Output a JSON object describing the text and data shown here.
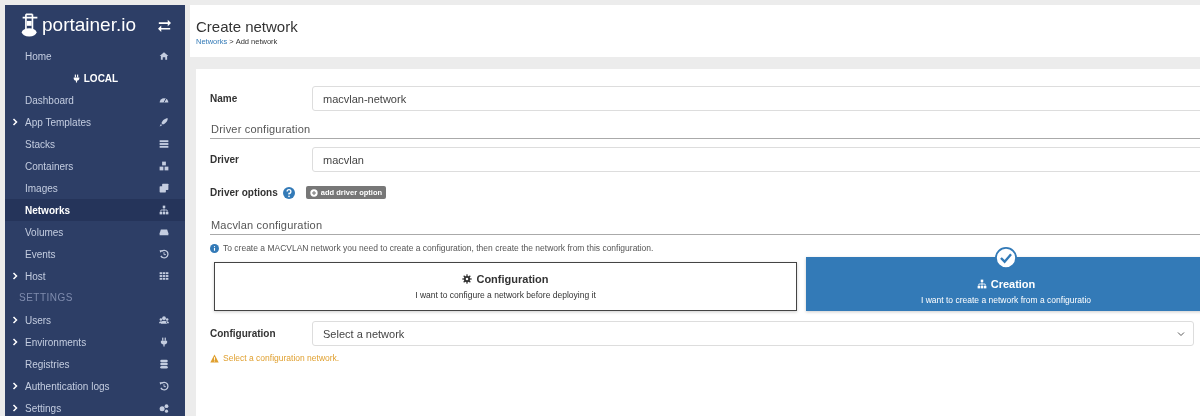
{
  "sidebar": {
    "logo": "portainer.io",
    "items": [
      {
        "kind": "link",
        "label": "Home",
        "expandable": false,
        "selected": false
      },
      {
        "kind": "endpoint",
        "label": "LOCAL"
      },
      {
        "kind": "link",
        "label": "Dashboard",
        "expandable": false,
        "selected": false
      },
      {
        "kind": "link",
        "label": "App Templates",
        "expandable": true,
        "selected": false
      },
      {
        "kind": "link",
        "label": "Stacks",
        "expandable": false,
        "selected": false
      },
      {
        "kind": "link",
        "label": "Containers",
        "expandable": false,
        "selected": false
      },
      {
        "kind": "link",
        "label": "Images",
        "expandable": false,
        "selected": false
      },
      {
        "kind": "link",
        "label": "Networks",
        "expandable": false,
        "selected": true
      },
      {
        "kind": "link",
        "label": "Volumes",
        "expandable": false,
        "selected": false
      },
      {
        "kind": "link",
        "label": "Events",
        "expandable": false,
        "selected": false
      },
      {
        "kind": "link",
        "label": "Host",
        "expandable": true,
        "selected": false
      },
      {
        "kind": "section",
        "label": "SETTINGS"
      },
      {
        "kind": "link",
        "label": "Users",
        "expandable": true,
        "selected": false
      },
      {
        "kind": "link",
        "label": "Environments",
        "expandable": true,
        "selected": false
      },
      {
        "kind": "link",
        "label": "Registries",
        "expandable": false,
        "selected": false
      },
      {
        "kind": "link",
        "label": "Authentication logs",
        "expandable": true,
        "selected": false
      },
      {
        "kind": "link",
        "label": "Settings",
        "expandable": true,
        "selected": false
      }
    ]
  },
  "header": {
    "title": "Create network",
    "breadcrumb": {
      "link": "Networks",
      "separator": ">",
      "current": "Add network"
    }
  },
  "form": {
    "name": {
      "label": "Name",
      "value": "macvlan-network"
    },
    "driver_section": "Driver configuration",
    "driver": {
      "label": "Driver",
      "value": "macvlan"
    },
    "driver_options": {
      "label": "Driver options",
      "button": "add driver option"
    },
    "macvlan_section": "Macvlan configuration",
    "info": "To create a MACVLAN network you need to create a configuration, then create the network from this configuration.",
    "cards": [
      {
        "title": "Configuration",
        "description": "I want to configure a network before deploying it",
        "selected": false
      },
      {
        "title": "Creation",
        "description": "I want to create a network from a configuratio",
        "selected": true
      }
    ],
    "configuration": {
      "label": "Configuration",
      "value": "Select a network"
    },
    "warning": "Select a configuration network."
  }
}
